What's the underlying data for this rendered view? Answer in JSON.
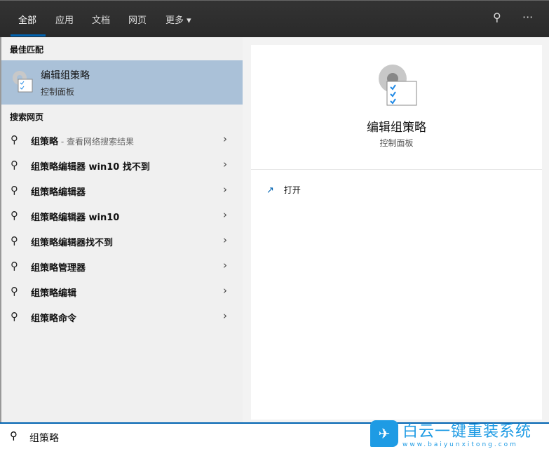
{
  "tabs": [
    "全部",
    "应用",
    "文档",
    "网页",
    "更多 ▾"
  ],
  "best_match": {
    "heading": "最佳匹配",
    "title": "编辑组策略",
    "subtitle": "控制面板"
  },
  "web": {
    "heading": "搜索网页",
    "items": [
      {
        "label": "组策略",
        "sub": " - 查看网络搜索结果"
      },
      {
        "label": "组策略编辑器 win10 找不到",
        "sub": ""
      },
      {
        "label": "组策略编辑器",
        "sub": ""
      },
      {
        "label": "组策略编辑器 win10",
        "sub": ""
      },
      {
        "label": "组策略编辑器找不到",
        "sub": ""
      },
      {
        "label": "组策略管理器",
        "sub": ""
      },
      {
        "label": "组策略编辑",
        "sub": ""
      },
      {
        "label": "组策略命令",
        "sub": ""
      }
    ]
  },
  "detail": {
    "title": "编辑组策略",
    "subtitle": "控制面板",
    "open": "打开"
  },
  "search": {
    "value": "组策略"
  },
  "watermark": {
    "cn": "白云一键重装系统",
    "en": "www.baiyunxitong.com"
  }
}
